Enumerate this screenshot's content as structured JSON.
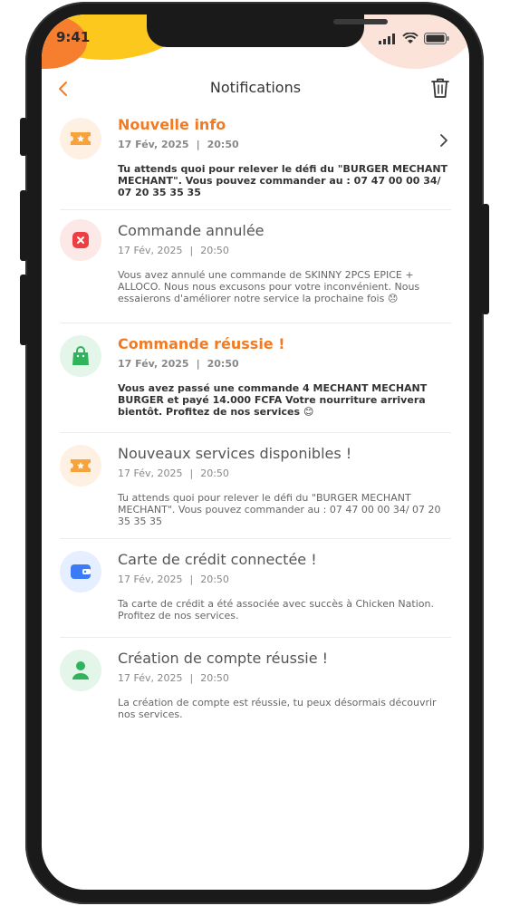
{
  "status": {
    "time": "9:41"
  },
  "header": {
    "title": "Notifications"
  },
  "colors": {
    "accent": "#f47a22",
    "unread_title": "#f47a22"
  },
  "notifications": [
    {
      "title": "Nouvelle info",
      "date": "17 Fév, 2025",
      "time": "20:50",
      "body": "Tu attends quoi pour relever le défi du \"BURGER MECHANT MECHANT\". Vous pouvez commander au : 07 47 00 00 34/ 07  20 35 35 35",
      "icon": "ticket-icon",
      "unread": true
    },
    {
      "title": "Commande annulée",
      "date": "17 Fév, 2025",
      "time": "20:50",
      "body": "Vous avez annulé une commande de SKINNY 2PCS EPICE + ALLOCO. Nous nous excusons pour votre inconvénient. Nous essaierons d'améliorer notre service la prochaine fois 😞",
      "icon": "cancel-icon",
      "unread": false
    },
    {
      "title": "Commande réussie !",
      "date": "17 Fév, 2025",
      "time": "20:50",
      "body": "Vous avez passé une commande 4 MECHANT MECHANT BURGER et payé 14.000 FCFA Votre nourriture arrivera bientôt. Profitez de nos services 😊",
      "icon": "shopping-bag-icon",
      "unread": true
    },
    {
      "title": "Nouveaux services disponibles !",
      "date": "17 Fév, 2025",
      "time": "20:50",
      "body": "Tu attends quoi pour relever le défi du \"BURGER MECHANT MECHANT\". Vous pouvez commander au : 07 47 00 00 34/ 07 20 35 35 35",
      "icon": "ticket-icon",
      "unread": false
    },
    {
      "title": "Carte de crédit connectée !",
      "date": "17 Fév, 2025",
      "time": "20:50",
      "body": "Ta carte de crédit a été associée avec succès à Chicken Nation. Profitez de nos services.",
      "icon": "wallet-icon",
      "unread": false
    },
    {
      "title": "Création de compte réussie !",
      "date": "17 Fév, 2025",
      "time": "20:50",
      "body": "La création de compte est réussie, tu peux désormais découvrir nos services.",
      "icon": "user-icon",
      "unread": false
    }
  ]
}
